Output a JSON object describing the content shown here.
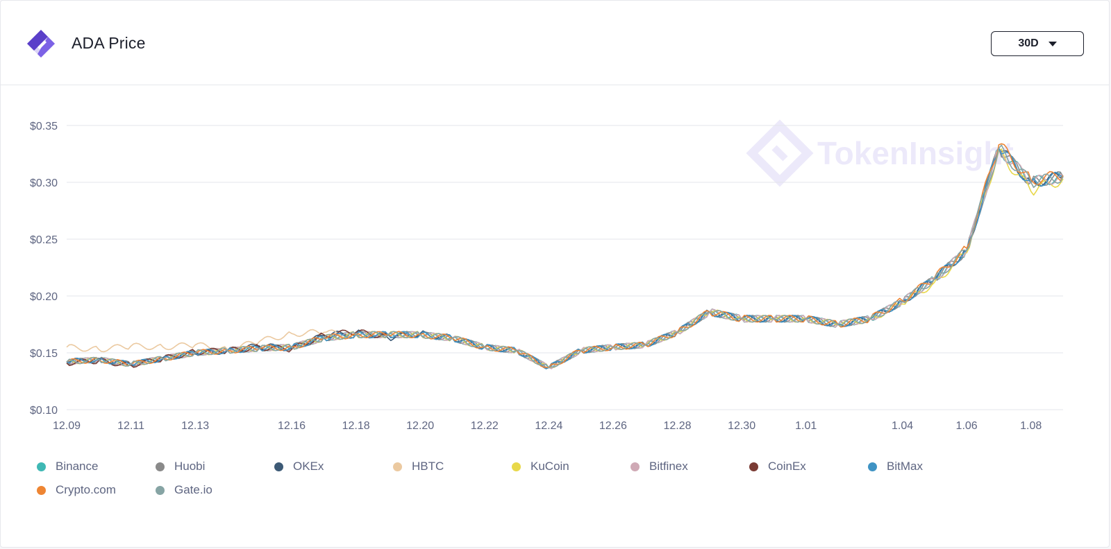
{
  "header": {
    "title": "ADA Price",
    "range_label": "30D",
    "logo_icon": "token-logo-icon"
  },
  "watermark": {
    "text": "TokenInsight"
  },
  "chart_data": {
    "type": "line",
    "title": "ADA Price",
    "xlabel": "",
    "ylabel": "",
    "x_ticks": [
      "12.09",
      "12.11",
      "12.13",
      "12.16",
      "12.18",
      "12.20",
      "12.22",
      "12.24",
      "12.26",
      "12.28",
      "12.30",
      "1.01",
      "1.04",
      "1.06",
      "1.08"
    ],
    "y_ticks": [
      "$0.35",
      "$0.30",
      "$0.25",
      "$0.20",
      "$0.15",
      "$0.10"
    ],
    "ylim": [
      0.1,
      0.35
    ],
    "grid": "horizontal",
    "legend_position": "bottom",
    "x": [
      "12.09",
      "12.10",
      "12.11",
      "12.12",
      "12.13",
      "12.14",
      "12.15",
      "12.16",
      "12.17",
      "12.18",
      "12.19",
      "12.20",
      "12.21",
      "12.22",
      "12.23",
      "12.24",
      "12.25",
      "12.26",
      "12.27",
      "12.28",
      "12.29",
      "12.30",
      "12.31",
      "1.01",
      "1.02",
      "1.03",
      "1.04",
      "1.05",
      "1.06",
      "1.07",
      "1.08",
      "1.09"
    ],
    "series": [
      {
        "name": "Binance",
        "color": "#3fb8b4",
        "values": [
          0.142,
          0.144,
          0.14,
          0.145,
          0.15,
          0.152,
          0.154,
          0.155,
          0.163,
          0.166,
          0.166,
          0.166,
          0.163,
          0.155,
          0.152,
          0.137,
          0.152,
          0.155,
          0.157,
          0.168,
          0.186,
          0.18,
          0.18,
          0.18,
          0.175,
          0.18,
          0.195,
          0.215,
          0.24,
          0.33,
          0.3,
          0.305
        ]
      },
      {
        "name": "Huobi",
        "color": "#8a8a8a",
        "values": [
          0.142,
          0.144,
          0.14,
          0.145,
          0.15,
          0.152,
          0.154,
          0.155,
          0.163,
          0.166,
          0.166,
          0.166,
          0.163,
          0.155,
          0.152,
          0.137,
          0.152,
          0.155,
          0.157,
          0.168,
          0.186,
          0.18,
          0.18,
          0.18,
          0.175,
          0.18,
          0.195,
          0.215,
          0.24,
          0.33,
          0.3,
          0.305
        ]
      },
      {
        "name": "OKEx",
        "color": "#3d5a76",
        "values": [
          0.142,
          0.145,
          0.139,
          0.146,
          0.149,
          0.152,
          0.156,
          0.154,
          0.165,
          0.168,
          0.163,
          0.167,
          0.163,
          0.155,
          0.152,
          0.137,
          0.152,
          0.155,
          0.157,
          0.168,
          0.186,
          0.18,
          0.18,
          0.18,
          0.175,
          0.18,
          0.195,
          0.215,
          0.24,
          0.33,
          0.3,
          0.305
        ]
      },
      {
        "name": "HBTC",
        "color": "#ebc9a0",
        "values": [
          0.155,
          0.153,
          0.156,
          0.155,
          0.157,
          0.153,
          0.16,
          0.167,
          0.168,
          0.165,
          null,
          null,
          null,
          null,
          null,
          null,
          null,
          null,
          null,
          null,
          null,
          null,
          null,
          null,
          null,
          null,
          null,
          null,
          null,
          null,
          null,
          null
        ]
      },
      {
        "name": "KuCoin",
        "color": "#e8d84a",
        "values": [
          0.142,
          0.144,
          0.14,
          0.145,
          0.15,
          0.152,
          0.154,
          0.155,
          0.163,
          0.166,
          0.166,
          0.166,
          0.163,
          0.155,
          0.152,
          0.137,
          0.152,
          0.155,
          0.157,
          0.168,
          0.186,
          0.18,
          0.18,
          0.18,
          0.175,
          0.18,
          0.193,
          0.212,
          0.238,
          0.328,
          0.292,
          0.303
        ]
      },
      {
        "name": "Bitfinex",
        "color": "#cfa9b5",
        "values": [
          0.142,
          0.144,
          0.14,
          0.145,
          0.15,
          0.152,
          0.154,
          0.155,
          0.163,
          0.166,
          0.166,
          0.166,
          0.163,
          0.155,
          0.152,
          0.137,
          0.152,
          0.155,
          0.157,
          0.168,
          0.186,
          0.18,
          0.18,
          0.18,
          0.175,
          0.18,
          0.195,
          0.215,
          0.24,
          0.33,
          0.3,
          0.305
        ]
      },
      {
        "name": "CoinEx",
        "color": "#7a3b34",
        "values": [
          0.141,
          0.143,
          0.139,
          0.145,
          0.151,
          0.152,
          0.155,
          0.153,
          0.166,
          0.168,
          0.165,
          null,
          null,
          null,
          null,
          null,
          null,
          null,
          null,
          null,
          null,
          null,
          null,
          null,
          null,
          null,
          null,
          null,
          null,
          null,
          null,
          null
        ]
      },
      {
        "name": "BitMax",
        "color": "#3f93c4",
        "values": [
          0.142,
          0.144,
          0.14,
          0.145,
          0.15,
          0.152,
          0.154,
          0.155,
          0.163,
          0.166,
          0.166,
          0.166,
          0.163,
          0.155,
          0.152,
          0.137,
          0.152,
          0.155,
          0.157,
          0.168,
          0.186,
          0.18,
          0.18,
          0.18,
          0.175,
          0.18,
          0.195,
          0.215,
          0.24,
          0.33,
          0.3,
          0.305
        ]
      },
      {
        "name": "Crypto.com",
        "color": "#ee8533",
        "values": [
          0.142,
          0.144,
          0.14,
          0.145,
          0.15,
          0.152,
          0.154,
          0.155,
          0.163,
          0.166,
          0.166,
          0.166,
          0.163,
          0.155,
          0.152,
          0.137,
          0.152,
          0.155,
          0.157,
          0.168,
          0.186,
          0.18,
          0.18,
          0.18,
          0.175,
          0.18,
          0.196,
          0.216,
          0.242,
          0.333,
          0.302,
          0.306
        ]
      },
      {
        "name": "Gate.io",
        "color": "#86a4a4",
        "values": [
          0.142,
          0.144,
          0.14,
          0.145,
          0.15,
          0.152,
          0.154,
          0.155,
          0.163,
          0.166,
          0.166,
          0.166,
          0.163,
          0.155,
          0.152,
          0.137,
          0.152,
          0.155,
          0.157,
          0.168,
          0.186,
          0.18,
          0.18,
          0.18,
          0.175,
          0.18,
          0.195,
          0.215,
          0.24,
          0.33,
          0.3,
          0.305
        ]
      }
    ]
  }
}
